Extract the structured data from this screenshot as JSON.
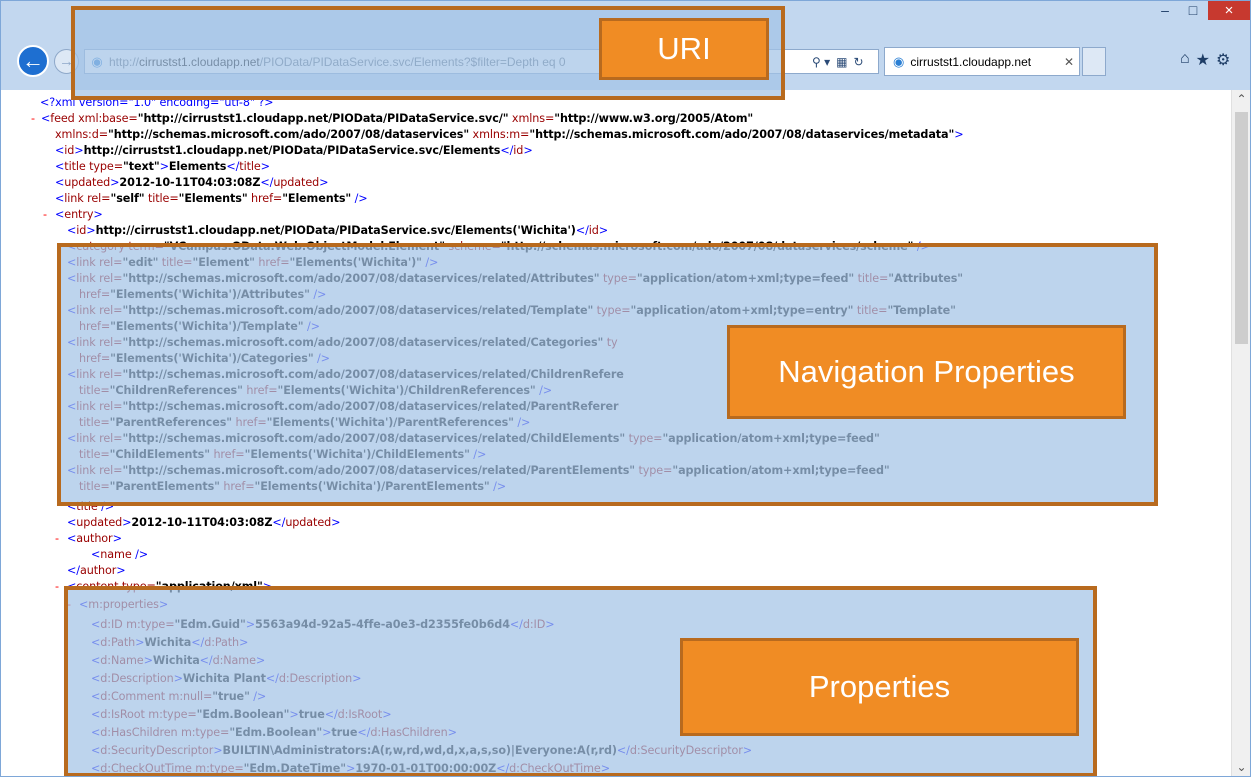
{
  "browser": {
    "address_host": "cirrustst1.cloudapp.net",
    "address_prefix": "http://",
    "address_path": "/PIOData/PIDataService.svc/Elements?$filter=Depth eq 0",
    "tab_title": "cirrustst1.cloudapp.net",
    "window_controls": {
      "minimize": "–",
      "maximize": "□",
      "close": "×"
    }
  },
  "xml": {
    "pi": "<?xml version=\"1.0\" encoding=\"utf-8\" ?>",
    "feed_base": "http://cirrustst1.cloudapp.net/PIOData/PIDataService.svc/",
    "feed_xmlns": "http://www.w3.org/2005/Atom",
    "ns_d": "http://schemas.microsoft.com/ado/2007/08/dataservices",
    "ns_m": "http://schemas.microsoft.com/ado/2007/08/dataservices/metadata",
    "feed_id": "http://cirrustst1.cloudapp.net/PIOData/PIDataService.svc/Elements",
    "title_type": "text",
    "title": "Elements",
    "updated": "2012-10-11T04:03:08Z",
    "link_rel": "self",
    "link_title": "Elements",
    "link_href": "Elements",
    "entry_id": "http://cirrustst1.cloudapp.net/PIOData/PIDataService.svc/Elements('Wichita')",
    "category_term": "VCampus.OData.Web.ObjectModel.Element",
    "category_scheme": "http://schemas.microsoft.com/ado/2007/08/dataservices/scheme",
    "edit_rel": "edit",
    "edit_title": "Element",
    "edit_href": "Elements('Wichita')",
    "nav": [
      {
        "rel": "http://schemas.microsoft.com/ado/2007/08/dataservices/related/Attributes",
        "type": "application/atom+xml;type=feed",
        "title": "Attributes",
        "href": "Elements('Wichita')/Attributes"
      },
      {
        "rel": "http://schemas.microsoft.com/ado/2007/08/dataservices/related/Template",
        "type": "application/atom+xml;type=entry",
        "title": "Template",
        "href": "Elements('Wichita')/Template"
      },
      {
        "rel": "http://schemas.microsoft.com/ado/2007/08/dataservices/related/Categories",
        "type": "ty",
        "title": "",
        "href": "Elements('Wichita')/Categories"
      },
      {
        "rel": "http://schemas.microsoft.com/ado/2007/08/dataservices/related/ChildrenRefere",
        "type": "",
        "title": "ChildrenReferences",
        "href": "Elements('Wichita')/ChildrenReferences"
      },
      {
        "rel": "http://schemas.microsoft.com/ado/2007/08/dataservices/related/ParentReferer",
        "type": "",
        "title": "ParentReferences",
        "href": "Elements('Wichita')/ParentReferences"
      },
      {
        "rel": "http://schemas.microsoft.com/ado/2007/08/dataservices/related/ChildElements",
        "type": "application/atom+xml;type=feed",
        "title": "ChildElements",
        "href": "Elements('Wichita')/ChildElements"
      },
      {
        "rel": "http://schemas.microsoft.com/ado/2007/08/dataservices/related/ParentElements",
        "type": "application/atom+xml;type=feed",
        "title": "ParentElements",
        "href": "Elements('Wichita')/ParentElements"
      }
    ],
    "entry_updated": "2012-10-11T04:03:08Z",
    "content_type": "application/xml",
    "props": {
      "id_type": "Edm.Guid",
      "id": "5563a94d-92a5-4ffe-a0e3-d2355fe0b6d4",
      "path": "Wichita",
      "name": "Wichita",
      "description": "Wichita Plant",
      "comment_null": "true",
      "isroot_type": "Edm.Boolean",
      "isroot": "true",
      "haschildren_type": "Edm.Boolean",
      "haschildren": "true",
      "security": "BUILTIN\\Administrators:A(r,w,rd,wd,d,x,a,s,so)|Everyone:A(r,rd)",
      "checkout_type": "Edm.DateTime",
      "checkout": "1970-01-01T00:00:00Z"
    }
  },
  "callouts": {
    "uri": "URI",
    "navigation": "Navigation Properties",
    "properties": "Properties"
  },
  "colors": {
    "callout_fill": "#f08c24",
    "callout_border": "#b86a1e",
    "highlight": "#a4c4e6",
    "xml_tag": "#990000",
    "xml_bracket": "#0000ff",
    "collapse_dash": "#ff0000"
  },
  "icons": [
    "back-arrow-icon",
    "forward-arrow-icon",
    "page-icon",
    "search-icon",
    "compatibility-icon",
    "refresh-icon",
    "home-icon",
    "favorites-star-icon",
    "settings-gear-icon"
  ]
}
